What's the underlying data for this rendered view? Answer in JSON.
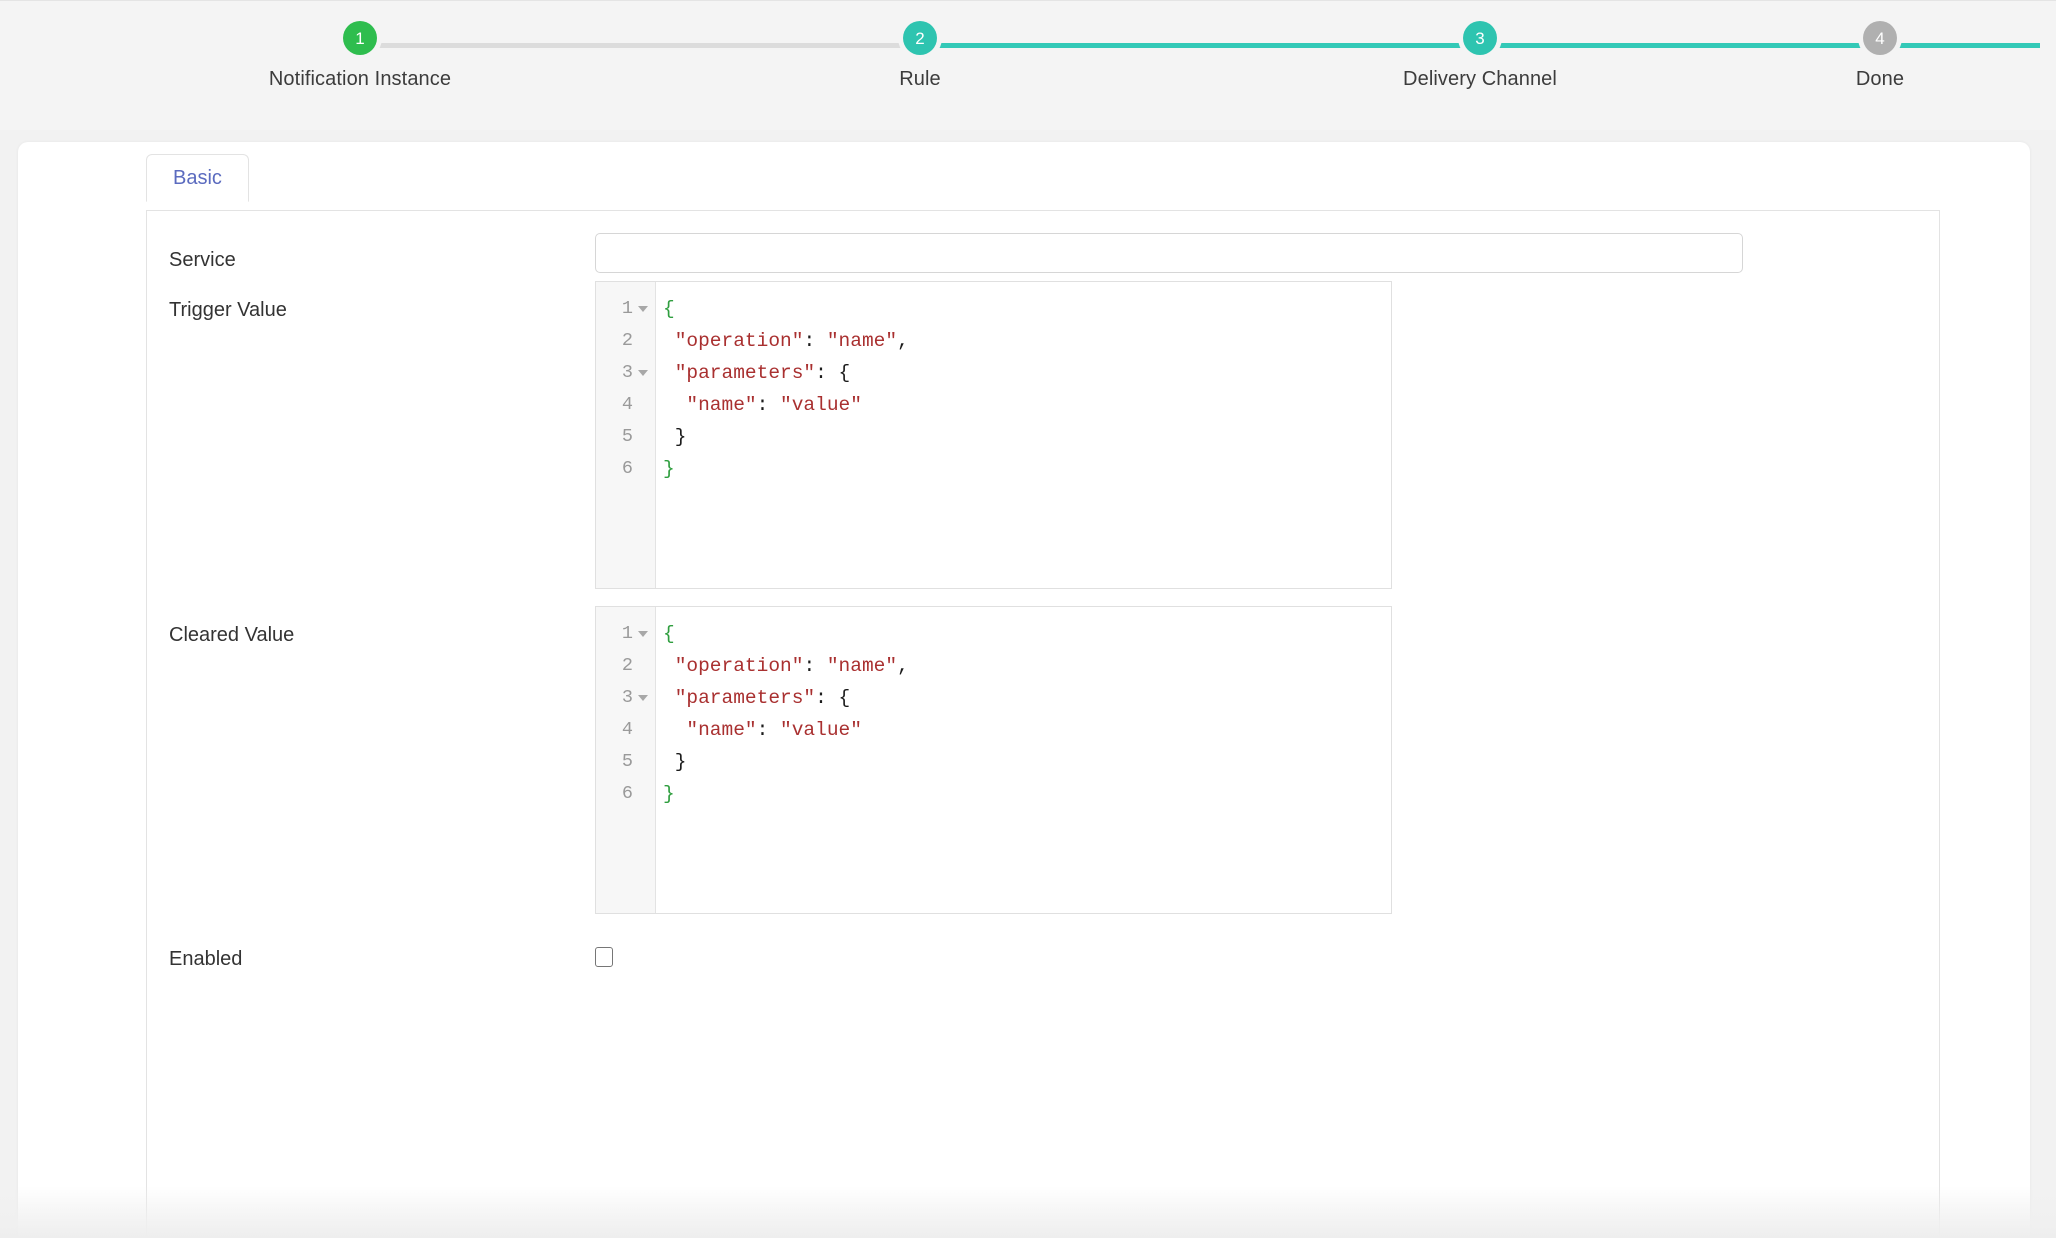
{
  "stepper": {
    "steps": [
      {
        "number": "1",
        "label": "Notification Instance",
        "state": "first"
      },
      {
        "number": "2",
        "label": "Rule",
        "state": "done"
      },
      {
        "number": "3",
        "label": "Delivery Channel",
        "state": "active"
      },
      {
        "number": "4",
        "label": "Done",
        "state": "pending"
      }
    ],
    "colors": {
      "first": "#2ebd4e",
      "active": "#2ec4b0",
      "pending": "#b0b0b0",
      "line_done": "#33c9b7",
      "line_pending": "#dcdcdc"
    }
  },
  "tabs": [
    {
      "label": "Basic",
      "active": true
    }
  ],
  "form": {
    "service": {
      "label": "Service",
      "value": "",
      "placeholder": ""
    },
    "trigger_value": {
      "label": "Trigger Value",
      "editor": {
        "lines": [
          {
            "n": "1",
            "foldable": true,
            "tokens": [
              {
                "t": "{",
                "c": "brace-outer"
              }
            ]
          },
          {
            "n": "2",
            "foldable": false,
            "tokens": [
              {
                "t": " ",
                "c": "punc"
              },
              {
                "t": "\"operation\"",
                "c": "str"
              },
              {
                "t": ": ",
                "c": "punc"
              },
              {
                "t": "\"name\"",
                "c": "str"
              },
              {
                "t": ",",
                "c": "punc"
              }
            ]
          },
          {
            "n": "3",
            "foldable": true,
            "tokens": [
              {
                "t": " ",
                "c": "punc"
              },
              {
                "t": "\"parameters\"",
                "c": "str"
              },
              {
                "t": ": {",
                "c": "punc"
              }
            ]
          },
          {
            "n": "4",
            "foldable": false,
            "tokens": [
              {
                "t": "  ",
                "c": "punc"
              },
              {
                "t": "\"name\"",
                "c": "str"
              },
              {
                "t": ": ",
                "c": "punc"
              },
              {
                "t": "\"value\"",
                "c": "str"
              }
            ]
          },
          {
            "n": "5",
            "foldable": false,
            "tokens": [
              {
                "t": " }",
                "c": "punc"
              }
            ]
          },
          {
            "n": "6",
            "foldable": false,
            "tokens": [
              {
                "t": "}",
                "c": "brace-outer"
              }
            ]
          }
        ],
        "text": "{\n \"operation\": \"name\",\n \"parameters\": {\n  \"name\": \"value\"\n }\n}"
      }
    },
    "cleared_value": {
      "label": "Cleared Value",
      "editor": {
        "lines": [
          {
            "n": "1",
            "foldable": true,
            "tokens": [
              {
                "t": "{",
                "c": "brace-outer"
              }
            ]
          },
          {
            "n": "2",
            "foldable": false,
            "tokens": [
              {
                "t": " ",
                "c": "punc"
              },
              {
                "t": "\"operation\"",
                "c": "str"
              },
              {
                "t": ": ",
                "c": "punc"
              },
              {
                "t": "\"name\"",
                "c": "str"
              },
              {
                "t": ",",
                "c": "punc"
              }
            ]
          },
          {
            "n": "3",
            "foldable": true,
            "tokens": [
              {
                "t": " ",
                "c": "punc"
              },
              {
                "t": "\"parameters\"",
                "c": "str"
              },
              {
                "t": ": {",
                "c": "punc"
              }
            ]
          },
          {
            "n": "4",
            "foldable": false,
            "tokens": [
              {
                "t": "  ",
                "c": "punc"
              },
              {
                "t": "\"name\"",
                "c": "str"
              },
              {
                "t": ": ",
                "c": "punc"
              },
              {
                "t": "\"value\"",
                "c": "str"
              }
            ]
          },
          {
            "n": "5",
            "foldable": false,
            "tokens": [
              {
                "t": " }",
                "c": "punc"
              }
            ]
          },
          {
            "n": "6",
            "foldable": false,
            "tokens": [
              {
                "t": "}",
                "c": "brace-outer"
              }
            ]
          }
        ],
        "text": "{\n \"operation\": \"name\",\n \"parameters\": {\n  \"name\": \"value\"\n }\n}"
      }
    },
    "enabled": {
      "label": "Enabled",
      "checked": false
    }
  },
  "theme": {
    "page_bg": "#f2f2f2",
    "card_bg": "#ffffff",
    "tab_text": "#5b6bbf",
    "label_text": "#333333",
    "code_string": "#a93030",
    "code_brace": "#2f9e3f",
    "gutter_bg": "#f7f7f7"
  }
}
